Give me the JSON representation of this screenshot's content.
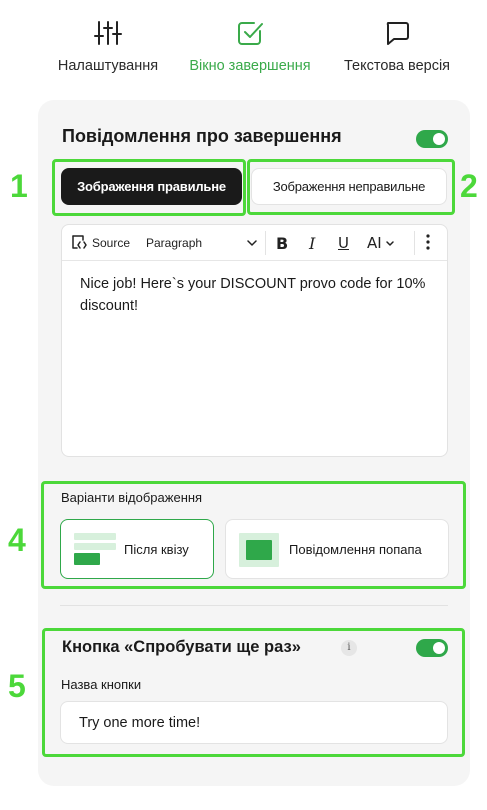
{
  "nav": {
    "items": [
      {
        "label": "Налаштування",
        "icon": "sliders-icon",
        "active": false
      },
      {
        "label": "Вікно завершення",
        "icon": "checkbox-icon",
        "active": true
      },
      {
        "label": "Текстова версія",
        "icon": "chat-bubble-icon",
        "active": false
      }
    ]
  },
  "completion": {
    "title": "Повідомлення про завершення",
    "enabled": true,
    "variant_correct": "Зображення правильне",
    "variant_incorrect": "Зображення неправильне"
  },
  "editor": {
    "toolbar": {
      "source": "Source",
      "paragraph": "Paragraph",
      "bold": "B",
      "italic": "I",
      "underline": "U",
      "text_size": "AI"
    },
    "content": "Nice job! Here`s your DISCOUNT provo code for 10% discount!"
  },
  "display": {
    "label": "Варіанти відображення",
    "options": [
      {
        "label": "Після квізу",
        "selected": true
      },
      {
        "label": "Повідомлення попапа",
        "selected": false
      }
    ]
  },
  "retry": {
    "title": "Кнопка «Спробувати ще раз»",
    "info_icon": "i",
    "enabled": true,
    "field_label": "Назва кнопки",
    "field_value": "Try one more time!"
  },
  "annotations": [
    "1",
    "2",
    "4",
    "5"
  ],
  "colors": {
    "accent": "#2fa84a",
    "annotation": "#4cd83a",
    "dark_button": "#1a1a1a",
    "panel_bg": "#f5f5f5"
  }
}
